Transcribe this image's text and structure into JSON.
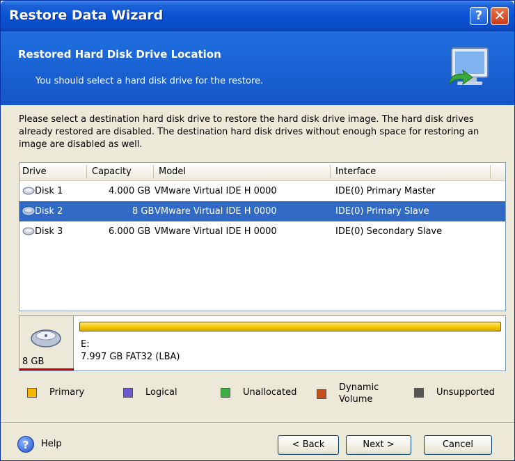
{
  "window": {
    "title": "Restore Data Wizard"
  },
  "titlebar_buttons": {
    "help": "?",
    "close": "✕"
  },
  "header": {
    "title": "Restored Hard Disk Drive Location",
    "subtitle": "You should select a hard disk drive for the restore."
  },
  "instructions": "Please select a destination hard disk drive to restore the hard disk drive image. The hard disk drives already restored are disabled. The destination hard disk drives without enough space for restoring an image are disabled as well.",
  "table": {
    "columns": [
      "Drive",
      "Capacity",
      "Model",
      "Interface"
    ],
    "rows": [
      {
        "drive": "Disk 1",
        "capacity": "4.000 GB",
        "model": "VMware Virtual IDE H 0000",
        "interface": "IDE(0) Primary Master"
      },
      {
        "drive": "Disk 2",
        "capacity": "8 GB",
        "model": "VMware Virtual IDE H 0000",
        "interface": "IDE(0) Primary Slave",
        "selected": true
      },
      {
        "drive": "Disk 3",
        "capacity": "6.000 GB",
        "model": "VMware Virtual IDE H 0000",
        "interface": "IDE(0) Secondary Slave"
      }
    ]
  },
  "partition": {
    "disk_size": "8 GB",
    "letter": "E:",
    "details": "7.997 GB  FAT32 (LBA)"
  },
  "legend": [
    {
      "label": "Primary",
      "color": "#f5b800"
    },
    {
      "label": "Logical",
      "color": "#6a5acd"
    },
    {
      "label": "Unallocated",
      "color": "#3cb043"
    },
    {
      "label_line1": "Dynamic",
      "label_line2": "Volume",
      "color": "#c4501a"
    },
    {
      "label": "Unsupported",
      "color": "#555555"
    }
  ],
  "footer": {
    "help_label": "Help",
    "back_label": "< Back",
    "next_label": "Next >",
    "cancel_label": "Cancel"
  },
  "colors": {
    "selection": "#316ac5",
    "header": "#1556c8"
  }
}
